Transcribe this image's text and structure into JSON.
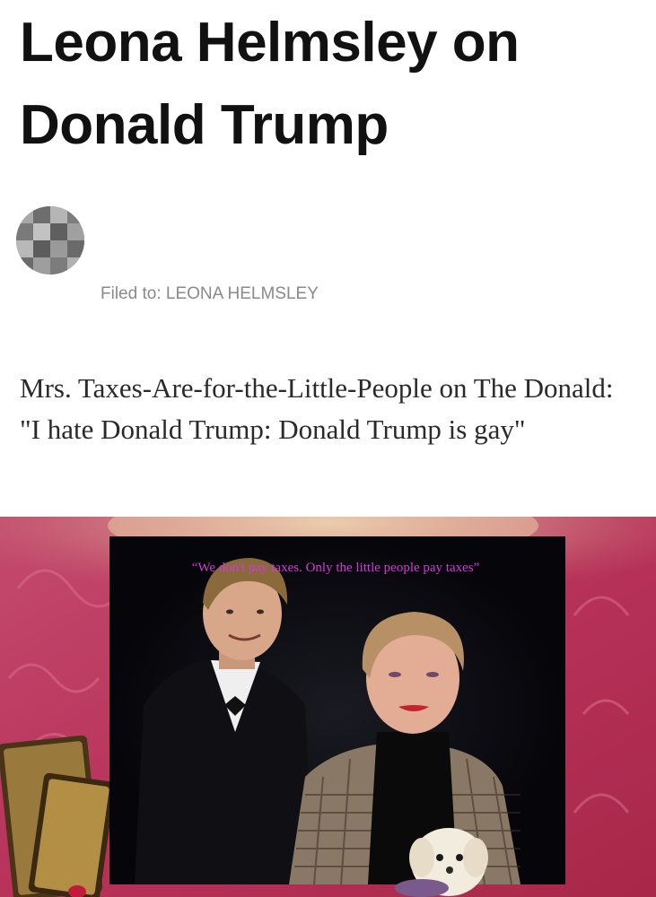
{
  "article": {
    "title": "Leona Helmsley on Donald Trump",
    "filed_prefix": "Filed to:",
    "filed_tag": "LEONA HELMSLEY",
    "dek": "Mrs. Taxes-Are-for-the-Little-People on The Donald: \"I hate Donald Trump: Donald Trump is gay\""
  },
  "hero_image": {
    "caption_quote": "“We don't pay taxes. Only the little people pay taxes”"
  }
}
